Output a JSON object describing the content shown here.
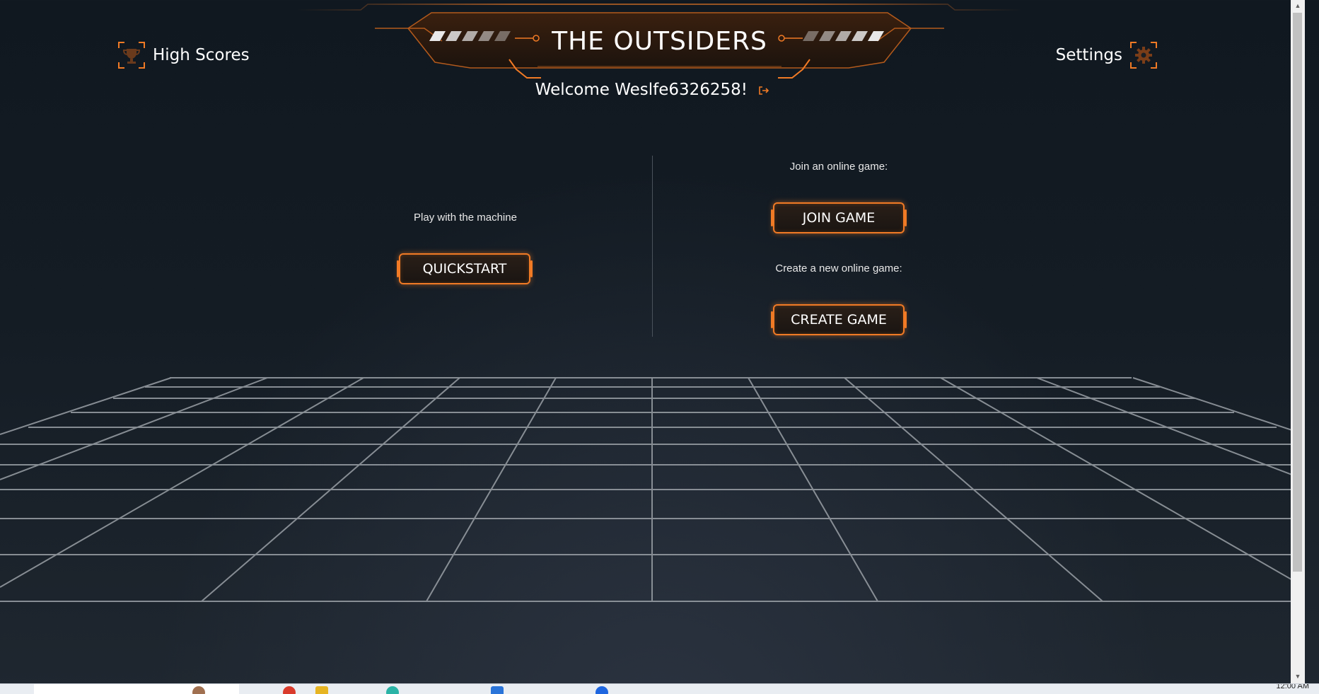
{
  "header": {
    "title": "THE OUTSIDERS",
    "welcome": "Welcome Weslfe6326258!"
  },
  "nav": {
    "high_scores": "High Scores",
    "settings": "Settings"
  },
  "left_panel": {
    "caption": "Play with the machine",
    "button": "QUICKSTART"
  },
  "right_panel": {
    "join_caption": "Join an online game:",
    "join_button": "JOIN GAME",
    "create_caption": "Create a new online game:",
    "create_button": "CREATE GAME"
  },
  "taskbar": {
    "clock": "12:00 AM"
  },
  "colors": {
    "accent": "#f07a25",
    "background": "#141c24",
    "grid_lines": "#9aa0a6"
  },
  "icons": [
    "trophy-icon",
    "gear-icon",
    "logout-icon"
  ]
}
